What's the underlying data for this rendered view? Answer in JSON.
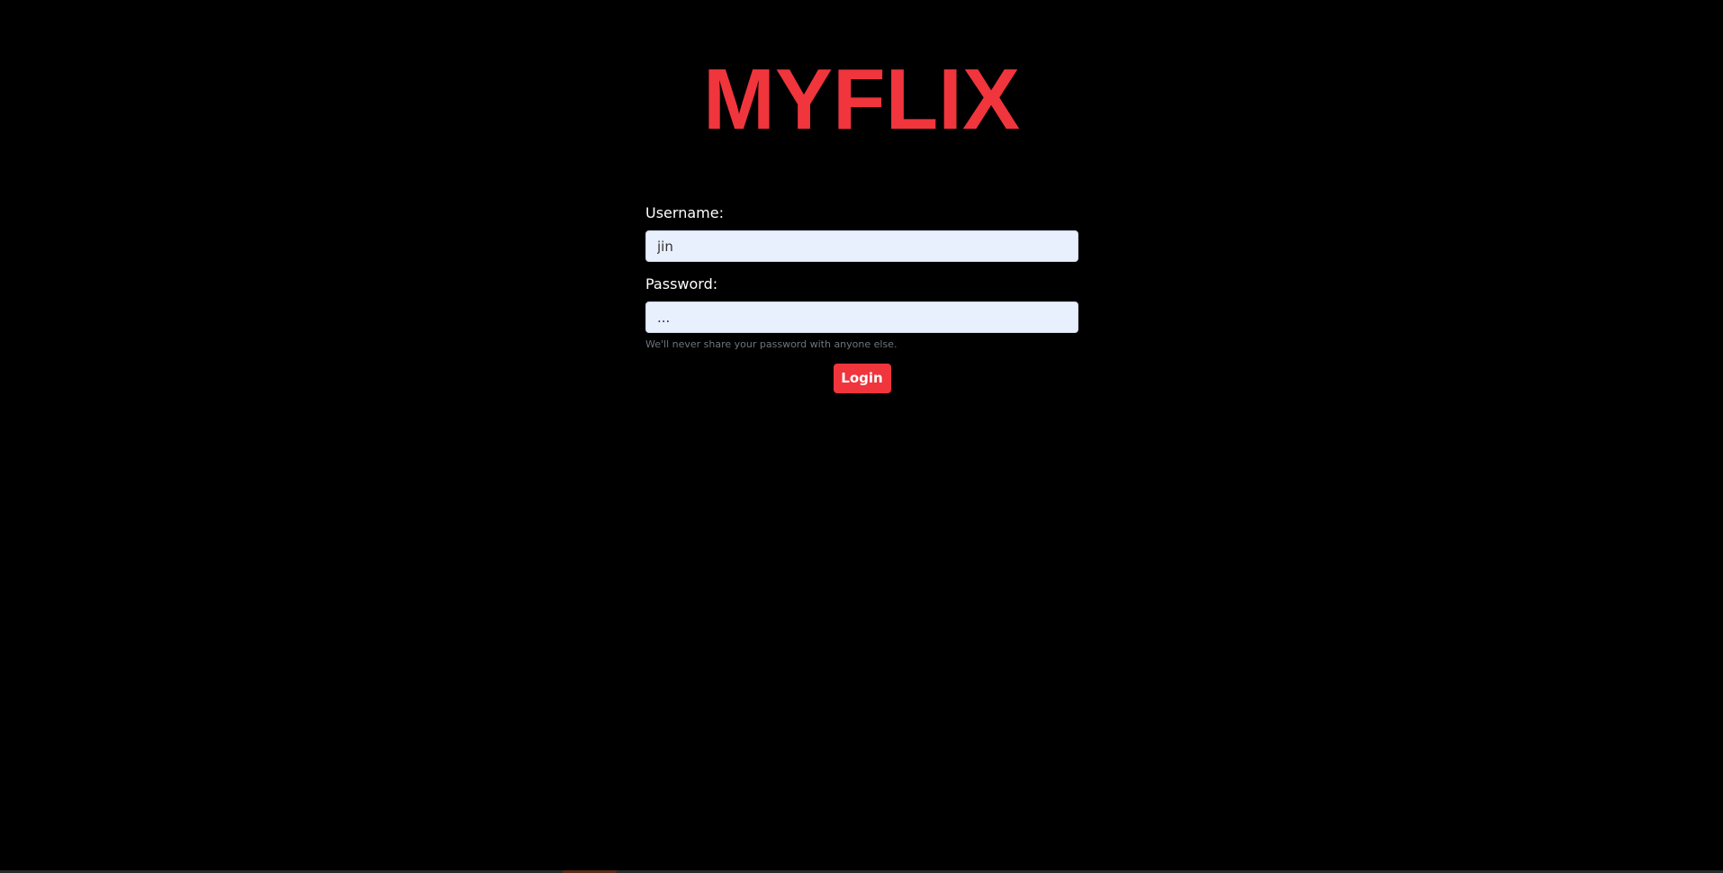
{
  "app": {
    "logo_text": "MYFLIX",
    "brand_color": "#f0353d",
    "background_color": "#000000"
  },
  "login": {
    "username_label": "Username:",
    "username_value": "jin",
    "password_label": "Password:",
    "password_value": "...",
    "password_help": "We'll never share your password with anyone else.",
    "submit_label": "Login"
  }
}
